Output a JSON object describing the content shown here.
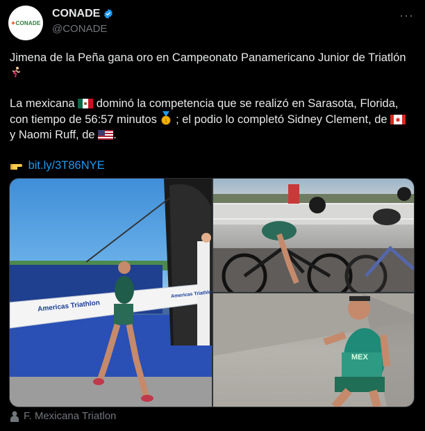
{
  "account": {
    "display_name": "CONADE",
    "handle": "@CONADE",
    "avatar_text": "CONADE"
  },
  "tweet": {
    "line1": "Jimena de la Peña gana oro en Campeonato Panamericano Junior de Triatlón",
    "para2_a": "La mexicana",
    "para2_b": "dominó la competencia que se realizó en Sarasota, Florida, con tiempo de 56:57 minutos",
    "para2_c": "; el podio lo completó Sidney Clement, de",
    "para2_d": "y Naomi Ruff, de",
    "para2_e": ".",
    "link": "bit.ly/3T86NYE"
  },
  "media": {
    "banner_text": "Americas Triathlon",
    "banner_text_short": "Americas Triathlon",
    "jersey_text": "MEX"
  },
  "footer": {
    "credit": "F. Mexicana Triatlon"
  },
  "icons": {
    "more": "more-options-icon",
    "verified": "verified-badge-icon",
    "runner": "runner-emoji-icon",
    "flag_mx": "mexico-flag-icon",
    "medal": "gold-medal-icon",
    "flag_ca": "canada-flag-icon",
    "flag_us": "usa-flag-icon",
    "point": "pointing-hand-icon",
    "person": "person-icon"
  },
  "colors": {
    "background": "#000000",
    "text": "#e7e9ea",
    "secondary": "#71767b",
    "link": "#1d9bf0",
    "verified": "#1d9bf0"
  }
}
